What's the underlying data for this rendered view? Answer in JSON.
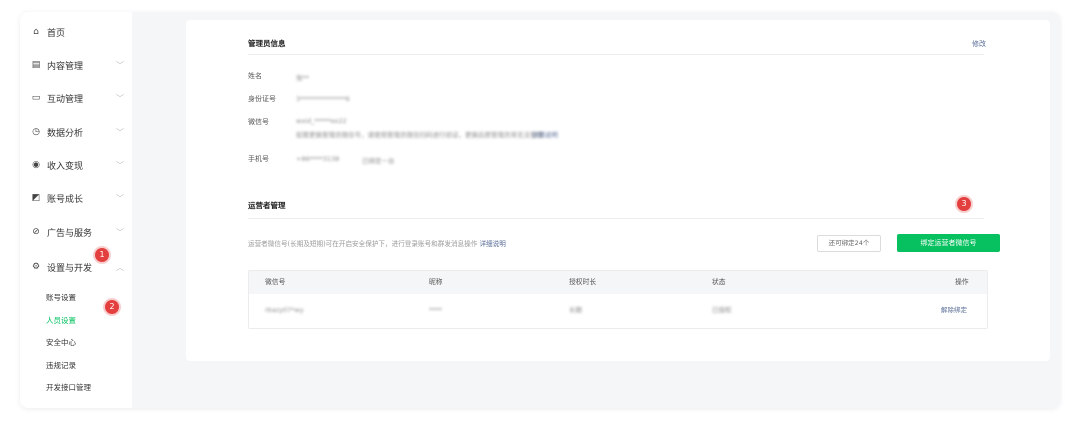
{
  "sidebar": {
    "items": [
      {
        "label": "首页",
        "icon": "home-icon",
        "glyph": "⌂",
        "expandable": false
      },
      {
        "label": "内容管理",
        "icon": "document-icon",
        "glyph": "▤",
        "expandable": true
      },
      {
        "label": "互动管理",
        "icon": "chat-icon",
        "glyph": "▭",
        "expandable": true
      },
      {
        "label": "数据分析",
        "icon": "clock-icon",
        "glyph": "◷",
        "expandable": true
      },
      {
        "label": "收入变现",
        "icon": "coin-icon",
        "glyph": "◉",
        "expandable": true
      },
      {
        "label": "账号成长",
        "icon": "chart-icon",
        "glyph": "◩",
        "expandable": true
      },
      {
        "label": "广告与服务",
        "icon": "check-circle-icon",
        "glyph": "⊘",
        "expandable": true
      },
      {
        "label": "设置与开发",
        "icon": "gear-icon",
        "glyph": "⚙",
        "expandable": true,
        "expanded": true
      }
    ],
    "sub_items": [
      {
        "label": "账号设置",
        "active": false
      },
      {
        "label": "人员设置",
        "active": true
      },
      {
        "label": "安全中心",
        "active": false
      },
      {
        "label": "违规记录",
        "active": false
      },
      {
        "label": "开发接口管理",
        "active": false
      }
    ],
    "badges": {
      "one": "1",
      "two": "2"
    }
  },
  "admin": {
    "title": "管理员信息",
    "edit": "修改",
    "name_label": "姓名",
    "name_value": "张**",
    "id_label": "身份证号",
    "id_value": "3**************6",
    "wechat_label": "微信号",
    "wechat_value": "wxid_*****ex22",
    "wechat_detail": "如需更换管理员微信号，请使用管理员微信扫码进行验证，更换后原管理员将无法登录",
    "wechat_detail_link": "详情说明",
    "phone_label": "手机号",
    "phone_value": "+86****3138",
    "phone_value2": "已绑定一台"
  },
  "operators": {
    "title": "运营者管理",
    "badge": "3",
    "description": "运营者微信号(长期及短期)可在开启安全保护下，进行登录账号和群发消息操作",
    "description_link": "详细说明",
    "quota": "还可绑定24个",
    "bind_button": "绑定运营者微信号",
    "columns": [
      "微信号",
      "昵称",
      "授权时长",
      "状态",
      "操作"
    ],
    "rows": [
      {
        "wechat": "rbazy07*wy",
        "nickname": "****",
        "duration": "长期",
        "status": "已授权",
        "action": "解除绑定"
      }
    ]
  },
  "colors": {
    "accent": "#07c160",
    "link": "#576b95",
    "badge": "#e33f3f"
  }
}
